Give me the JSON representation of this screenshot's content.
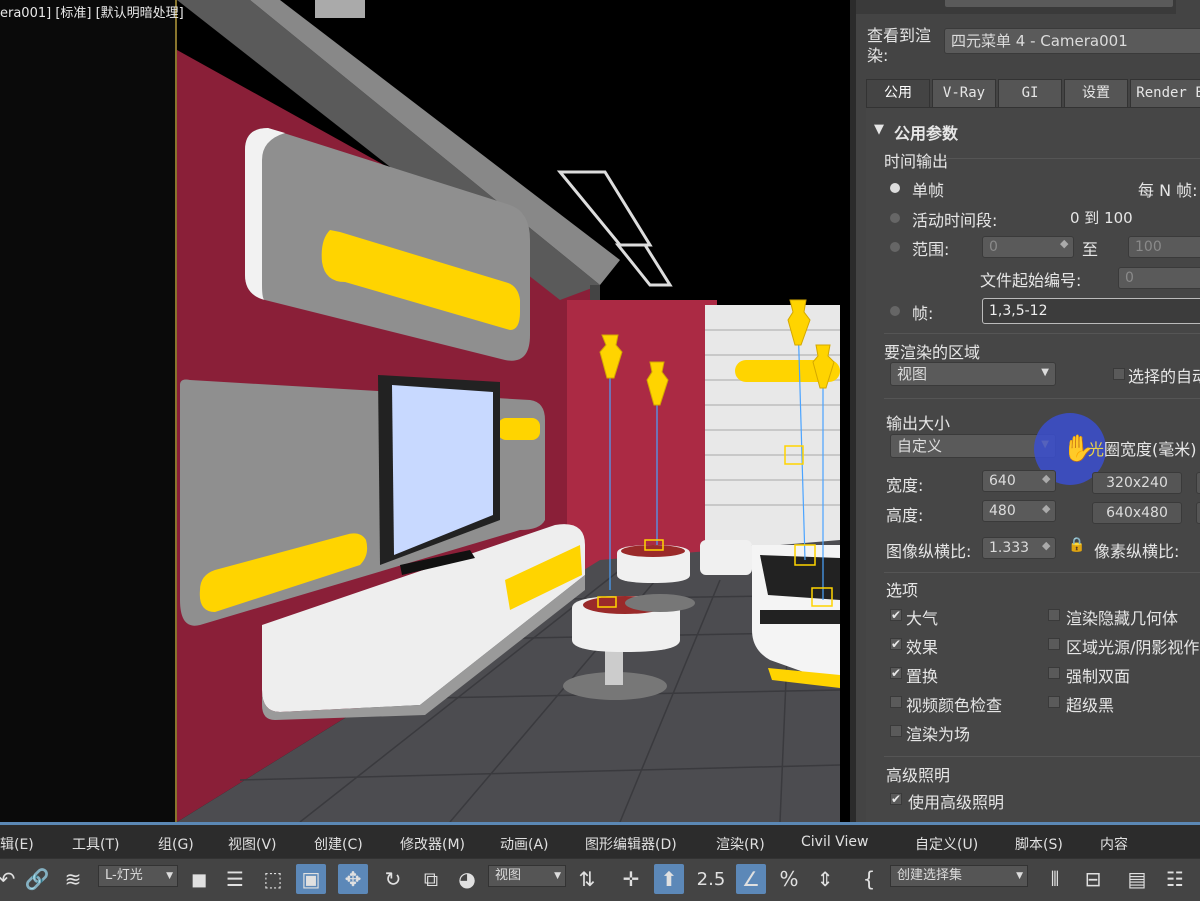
{
  "viewport": {
    "label": "era001] [标准] [默认明暗处理]"
  },
  "panel": {
    "view_to_render_label_line1": "查看到渲",
    "view_to_render_label_line2": "染:",
    "view_to_render_value": "四元菜单 4 - Camera001",
    "tabs": [
      "公用",
      "V-Ray",
      "GI",
      "设置",
      "Render E"
    ],
    "active_tab": 0,
    "rollout_title": "公用参数",
    "time_output": {
      "title": "时间输出",
      "single": "单帧",
      "every_n": "每 N 帧:",
      "active_segment": "活动时间段:",
      "active_range": "0 到 100",
      "range": "范围:",
      "range_from": "0",
      "range_to_label": "至",
      "range_to": "100",
      "file_start": "文件起始编号:",
      "file_start_value": "0",
      "frames": "帧:",
      "frames_value": "1,3,5-12"
    },
    "area": {
      "title": "要渲染的区域",
      "value": "视图",
      "auto_region": "选择的自动"
    },
    "output_size": {
      "title": "输出大小",
      "preset": "自定义",
      "aperture_highlight": "光",
      "aperture_rest": "圈宽度(毫米)",
      "width_label": "宽度:",
      "width": "640",
      "height_label": "高度:",
      "height": "480",
      "preset1": "320x240",
      "preset2": "640x480",
      "aspect_label": "图像纵横比:",
      "aspect": "1.333",
      "pixel_aspect_label": "像素纵横比:"
    },
    "options": {
      "title": "选项",
      "left": [
        {
          "label": "大气",
          "checked": true
        },
        {
          "label": "效果",
          "checked": true
        },
        {
          "label": "置换",
          "checked": true
        },
        {
          "label": "视频颜色检查",
          "checked": false
        },
        {
          "label": "渲染为场",
          "checked": false
        }
      ],
      "right": [
        {
          "label": "渲染隐藏几何体",
          "checked": false
        },
        {
          "label": "区域光源/阴影视作",
          "checked": false
        },
        {
          "label": "强制双面",
          "checked": false
        },
        {
          "label": "超级黑",
          "checked": false
        }
      ]
    },
    "advanced_lighting": {
      "title": "高级照明",
      "use": "使用高级照明"
    }
  },
  "menubar": {
    "items": [
      "辑(E)",
      "工具(T)",
      "组(G)",
      "视图(V)",
      "创建(C)",
      "修改器(M)",
      "动画(A)",
      "图形编辑器(D)",
      "渲染(R)",
      "Civil View",
      "自定义(U)",
      "脚本(S)",
      "内容"
    ]
  },
  "toolbar": {
    "selection_filter": "L-灯光",
    "ref_coord": "视图",
    "named_selection": "创建选择集",
    "snap_label": "2.5"
  },
  "colors": {
    "accent_blue": "#5c88b8",
    "panel_bg": "#444444",
    "wall_red": "#8a1f38",
    "highlight_yellow": "#ffd400"
  }
}
